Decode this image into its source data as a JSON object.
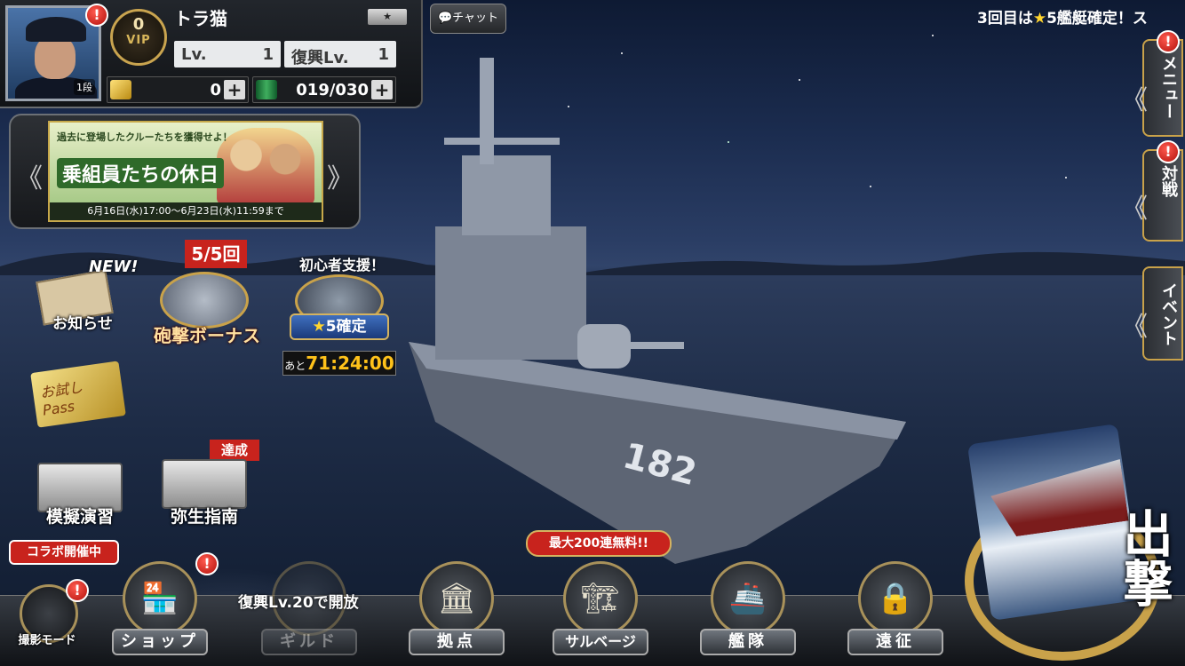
{
  "player": {
    "name": "トラ猫",
    "rank_badge": "1段",
    "vip_level": "0",
    "vip_label": "VIP",
    "level_label": "Lv.",
    "level": "1",
    "fukko_label": "復興Lv.",
    "fukko_level": "1",
    "gold": "0",
    "fuel": "019/030",
    "plus": "+"
  },
  "alert_mark": "!",
  "chat_label": "チャット",
  "ticker": {
    "prefix": "3回目は",
    "star": "★",
    "text": "5艦艇確定！ス"
  },
  "banner": {
    "line1": "過去に登場したクルーたちを獲得せよ！",
    "title": "乗組員たちの休日",
    "dates": "6月16日(水)17:00～6月23日(水)11:59まで",
    "left_arrow": "《",
    "right_arrow": "》"
  },
  "left_icons": {
    "notice": {
      "new": "NEW!",
      "label": "お知らせ"
    },
    "pass": {
      "label": "お試しPass"
    },
    "bonus": {
      "count": "5/5回",
      "label": "砲撃ボーナス"
    },
    "support": {
      "header": "初心者支援！",
      "star": "★",
      "guarantee": "5確定",
      "remaining_label": "あと",
      "timer": "71:24:00"
    },
    "mogi": {
      "label": "模擬演習"
    },
    "yayoi": {
      "tag": "達成",
      "label": "弥生指南"
    }
  },
  "right_tabs": {
    "menu": "メニュー",
    "battle": "対戦",
    "event": "イベント",
    "chevron": "《"
  },
  "bottom": {
    "collab": "コラボ開催中",
    "camera": "撮影モード",
    "shop": "ショップ",
    "unlock_note": "復興Lv.20で開放",
    "guild": "ギルド",
    "base": "拠点",
    "salvage_tag": "最大200連無料!!",
    "salvage": "サルベージ",
    "fleet": "艦隊",
    "expedition": "遠征"
  },
  "sortie": {
    "label": "出撃"
  },
  "ship": {
    "hull_number": "182"
  }
}
